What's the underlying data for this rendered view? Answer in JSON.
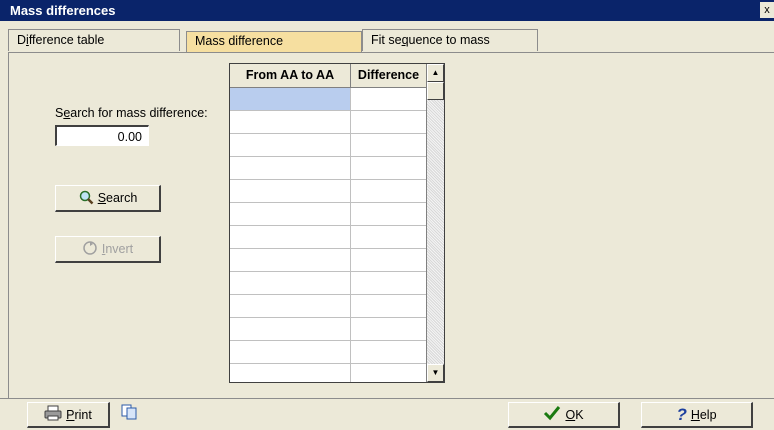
{
  "window": {
    "title": "Mass differences",
    "close_glyph": "x"
  },
  "tabs": [
    {
      "label": "Difference table",
      "underline": "i",
      "active": false
    },
    {
      "label": "Mass difference",
      "underline": "M",
      "active": true
    },
    {
      "label": "Fit sequence to mass",
      "underline": "q",
      "active": false
    }
  ],
  "search": {
    "label_pre": "S",
    "label_u": "e",
    "label_post": "arch for mass difference:",
    "value": "0.00"
  },
  "buttons": {
    "search": {
      "u": "S",
      "rest": "earch",
      "icon": "magnifier-icon"
    },
    "invert": {
      "u": "I",
      "rest": "nvert",
      "icon": "invert-icon",
      "disabled": true
    },
    "print": {
      "u": "P",
      "rest": "rint",
      "icon": "printer-icon"
    },
    "ok": {
      "u": "O",
      "rest": "K",
      "icon": "checkmark-icon"
    },
    "help": {
      "u": "H",
      "rest": "elp",
      "icon": "question-icon"
    }
  },
  "table": {
    "headers": [
      "From AA to AA",
      "Difference"
    ],
    "rows": 13
  },
  "colors": {
    "title_bar": "#0a246a",
    "active_tab": "#f6dfa0",
    "selection": "#b9cdee",
    "ok_check": "#1a7a10",
    "help_q": "#1c3f9e"
  }
}
